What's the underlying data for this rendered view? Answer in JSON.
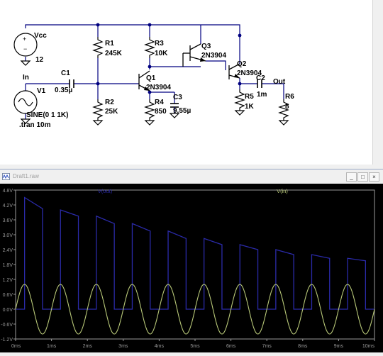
{
  "schematic": {
    "labels": {
      "vcc": "Vcc",
      "v_12": "12",
      "r1": "R1",
      "r1_val": "245K",
      "r3": "R3",
      "r3_val": "10K",
      "q3": "Q3",
      "q3_model": "2N3904",
      "in": "In",
      "c1": "C1",
      "c1_val": "0.35µ",
      "v1": "V1",
      "q1": "Q1",
      "q1_model": "2N3904",
      "q2": "Q2",
      "q2_model": "2N3904",
      "c2": "C2",
      "c2_val": "1m",
      "out": "Out",
      "c3": "C3",
      "c3_val": "9.55µ",
      "r2": "R2",
      "r2_val": "25K",
      "r4": "R4",
      "r4_val": "850",
      "r5": "R5",
      "r5_val": "1K",
      "r6": "R6",
      "r6_val": "8",
      "sine": "SINE(0 1 1K)",
      "tran": ".tran 10m"
    }
  },
  "plot_window": {
    "title": "Draft1.raw",
    "buttons": {
      "minimize": "_",
      "restore": "□",
      "close": "×"
    }
  },
  "chart_data": {
    "type": "line",
    "title": "",
    "legend": [
      "V(out)",
      "V(in)"
    ],
    "xlabel": "",
    "ylabel": "",
    "xlim": [
      0,
      10
    ],
    "ylim": [
      -1.2,
      4.8
    ],
    "xticks": [
      "0ms",
      "1ms",
      "2ms",
      "3ms",
      "4ms",
      "5ms",
      "6ms",
      "7ms",
      "8ms",
      "9ms",
      "10ms"
    ],
    "yticks": [
      "4.8V",
      "4.2V",
      "3.6V",
      "3.0V",
      "2.4V",
      "1.8V",
      "1.2V",
      "0.6V",
      "0.0V",
      "-0.6V",
      "-1.2V"
    ],
    "series": [
      {
        "name": "V(out)",
        "color": "#2a2aa8",
        "x": [
          0,
          0.25,
          0.25,
          0.75,
          0.75,
          1.25,
          1.25,
          1.75,
          1.75,
          2.25,
          2.25,
          2.75,
          2.75,
          3.25,
          3.25,
          3.75,
          3.75,
          4.25,
          4.25,
          4.75,
          4.75,
          5.25,
          5.25,
          5.75,
          5.75,
          6.25,
          6.25,
          6.75,
          6.75,
          7.25,
          7.25,
          7.75,
          7.75,
          8.25,
          8.25,
          8.75,
          8.75,
          9.25,
          9.25,
          9.75,
          9.75,
          10
        ],
        "y": [
          0,
          0,
          4.5,
          4.05,
          0,
          0,
          4.0,
          3.75,
          0,
          0,
          3.75,
          3.45,
          0,
          0,
          3.45,
          3.15,
          0,
          0,
          3.15,
          2.85,
          0,
          0,
          2.85,
          2.6,
          0,
          0,
          2.6,
          2.4,
          0,
          0,
          2.4,
          2.2,
          0,
          0,
          2.2,
          2.05,
          0,
          0,
          2.05,
          1.95,
          0,
          0
        ]
      },
      {
        "name": "V(in)",
        "color": "#b8c878",
        "function": "sine",
        "amplitude": 1,
        "frequency_khz": 1,
        "offset": 0
      }
    ]
  }
}
